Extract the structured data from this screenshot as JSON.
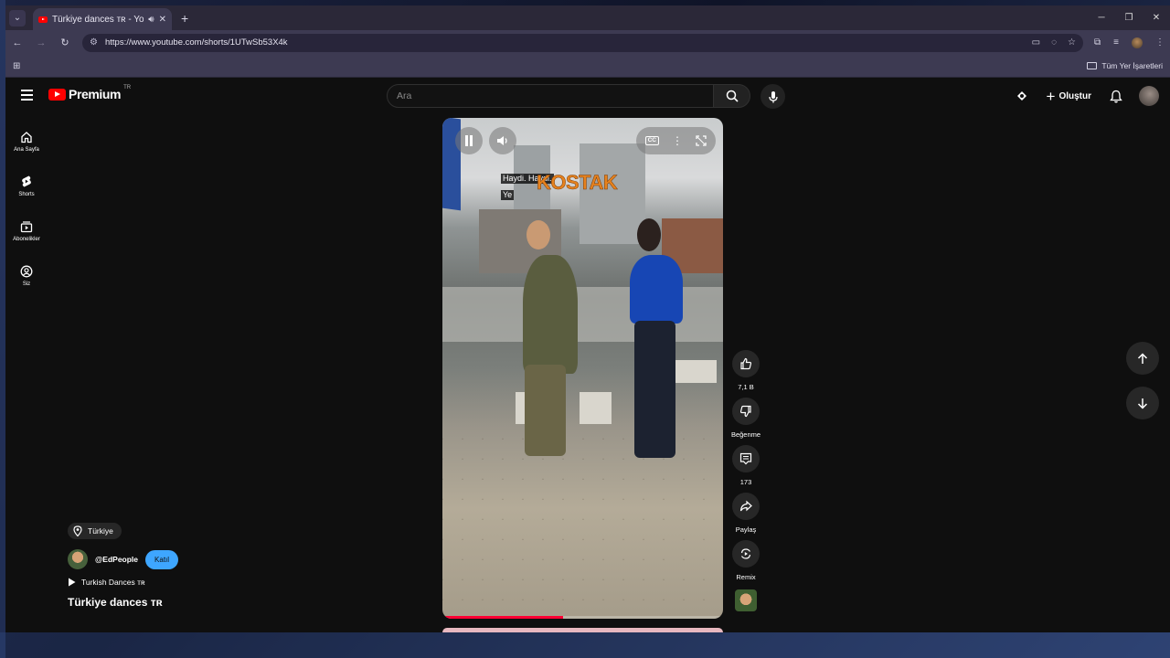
{
  "browser": {
    "tab_title": "Türkiye dances ʀ - YouTube",
    "tab_title_display": "Türkiye dances ᴛʀ - YouTub",
    "url": "https://www.youtube.com/shorts/1UTwSb53X4k",
    "bookmarks_all": "Tüm Yer İşaretleri"
  },
  "youtube": {
    "logo_text": "Premium",
    "logo_country": "TR",
    "search_placeholder": "Ara",
    "create_label": "Oluştur",
    "sidebar": [
      {
        "label": "Ana Sayfa",
        "icon": "home-icon"
      },
      {
        "label": "Shorts",
        "icon": "shorts-icon"
      },
      {
        "label": "Abonelikler",
        "icon": "subscriptions-icon"
      },
      {
        "label": "Siz",
        "icon": "you-icon"
      }
    ],
    "player": {
      "caption_line1": "Haydi. Haydi.",
      "caption_line2": "Ye",
      "overlay_text": "KOSTAK",
      "cc_label": "CC",
      "progress_fraction": 0.43
    },
    "actions": {
      "likes": "7,1 B",
      "dislike_label": "Beğenme",
      "comments": "173",
      "share_label": "Paylaş",
      "remix_label": "Remix"
    },
    "meta": {
      "location": "Türkiye",
      "channel": "@EdPeople",
      "join_label": "Katıl",
      "playlist": "Turkish Dances ᴛʀ",
      "title": "Türkiye dances ᴛʀ"
    }
  }
}
